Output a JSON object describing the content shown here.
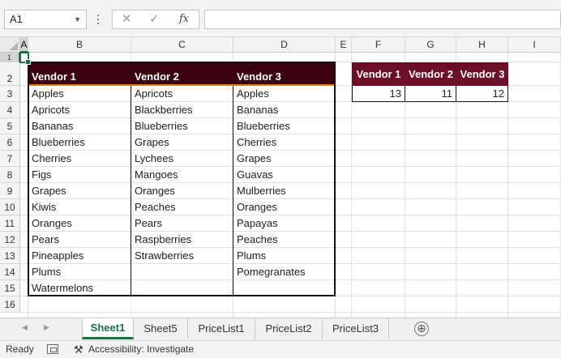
{
  "formula_bar": {
    "name_box": "A1",
    "name_box_chevron_icon": "chevron-down-icon",
    "cancel_icon": "✕",
    "enter_icon": "✓",
    "fx_label": "fx",
    "formula": ""
  },
  "columns": [
    "A",
    "B",
    "C",
    "D",
    "E",
    "F",
    "G",
    "H",
    "I"
  ],
  "rows": [
    "1",
    "2",
    "3",
    "4",
    "5",
    "6",
    "7",
    "8",
    "9",
    "10",
    "11",
    "12",
    "13",
    "14",
    "15",
    "16"
  ],
  "table": {
    "headers": [
      "Vendor 1",
      "Vendor 2",
      "Vendor 3"
    ],
    "vendor1": [
      "Apples",
      "Apricots",
      "Bananas",
      "Blueberries",
      "Cherries",
      "Figs",
      "Grapes",
      "Kiwis",
      "Oranges",
      "Pears",
      "Pineapples",
      "Plums",
      "Watermelons"
    ],
    "vendor2": [
      "Apricots",
      "Blackberries",
      "Blueberries",
      "Grapes",
      "Lychees",
      "Mangoes",
      "Oranges",
      "Peaches",
      "Pears",
      "Raspberries",
      "Strawberries"
    ],
    "vendor3": [
      "Apples",
      "Bananas",
      "Blueberries",
      "Cherries",
      "Grapes",
      "Guavas",
      "Mulberries",
      "Oranges",
      "Papayas",
      "Peaches",
      "Plums",
      "Pomegranates"
    ]
  },
  "summary": {
    "headers": [
      "Vendor 1",
      "Vendor 2",
      "Vendor 3"
    ],
    "counts": [
      "13",
      "11",
      "12"
    ]
  },
  "colors": {
    "header_bg": "#3a0010",
    "summary_header_bg": "#6b0f28",
    "accent": "#1e7145",
    "header_underline": "#e07b1a"
  },
  "sheets": {
    "tabs": [
      "Sheet1",
      "Sheet5",
      "PriceList1",
      "PriceList2",
      "PriceList3"
    ],
    "active": "Sheet1",
    "add_icon": "⊕"
  },
  "status": {
    "mode": "Ready",
    "accessibility": "Accessibility: Investigate"
  }
}
